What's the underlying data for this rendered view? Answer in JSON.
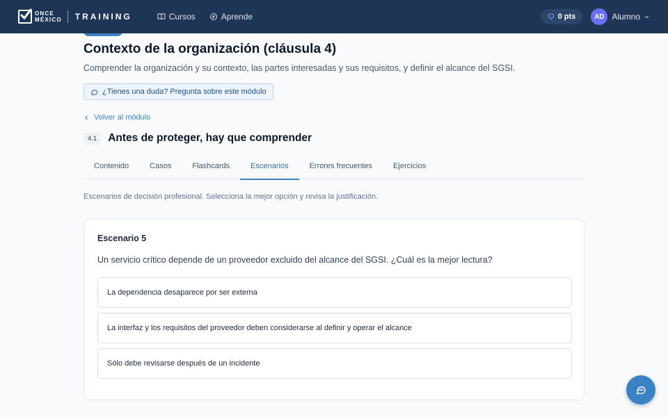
{
  "header": {
    "logo_top": "ONCE",
    "logo_bottom": "MÉXICO",
    "logo_product": "TRAINING",
    "nav": [
      {
        "label": "Cursos",
        "icon": "book-icon"
      },
      {
        "label": "Aprende",
        "icon": "compass-icon"
      }
    ],
    "points": "0 pts",
    "user_initials": "AD",
    "user_name": "Alumno"
  },
  "module": {
    "title": "Contexto de la organización (cláusula 4)",
    "description": "Comprender la organización y su contexto, las partes interesadas y sus requisitos, y definir el alcance del SGSI.",
    "ask_label": "¿Tienes una duda? Pregunta sobre este módulo",
    "back_label": "Volver al módulo"
  },
  "lesson": {
    "number": "4.1",
    "title": "Antes de proteger, hay que comprender"
  },
  "tabs": [
    {
      "label": "Contenido",
      "active": false
    },
    {
      "label": "Casos",
      "active": false
    },
    {
      "label": "Flashcards",
      "active": false
    },
    {
      "label": "Escenarios",
      "active": true
    },
    {
      "label": "Errores frecuentes",
      "active": false
    },
    {
      "label": "Ejercicios",
      "active": false
    }
  ],
  "scenarios": {
    "intro": "Escenarios de decisión profesional. Selecciona la mejor opción y revisa la justificación.",
    "label": "Escenario 5",
    "question": "Un servicio crítico depende de un proveedor excluido del alcance del SGSI. ¿Cuál es la mejor lectura?",
    "options": [
      "La dependencia desaparece por ser externa",
      "La interfaz y los requisitos del proveedor deben considerarse al definir y operar el alcance",
      "Sólo debe revisarse después de un incidente"
    ]
  },
  "colors": {
    "header_bg": "#1e3556",
    "accent": "#3b82c4",
    "avatar": "#6b6ff2"
  }
}
